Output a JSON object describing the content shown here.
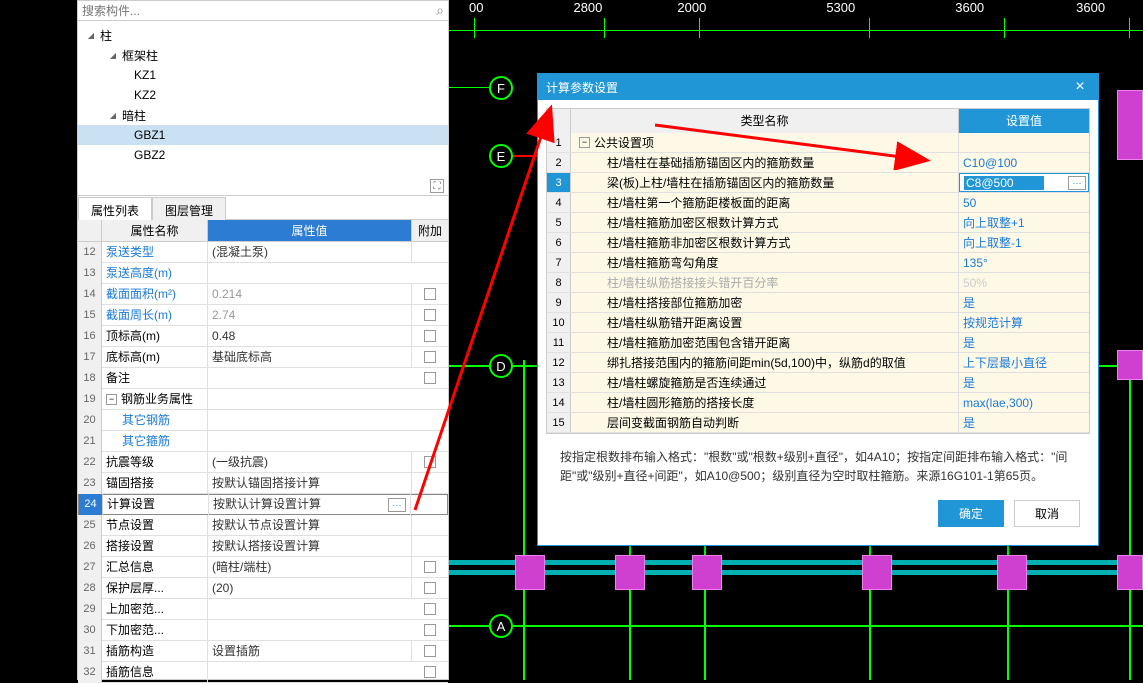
{
  "search": {
    "placeholder": "搜索构件..."
  },
  "tree": {
    "items": [
      {
        "label": "柱",
        "level": 0,
        "caret": true
      },
      {
        "label": "框架柱",
        "level": 1,
        "caret": true
      },
      {
        "label": "KZ1",
        "level": 2
      },
      {
        "label": "KZ2",
        "level": 2
      },
      {
        "label": "暗柱",
        "level": 1,
        "caret": true
      },
      {
        "label": "GBZ1",
        "level": 2,
        "selected": true
      },
      {
        "label": "GBZ2",
        "level": 2
      }
    ]
  },
  "tabs": [
    {
      "label": "属性列表",
      "active": true
    },
    {
      "label": "图层管理",
      "active": false
    }
  ],
  "property_header": {
    "name": "属性名称",
    "value": "属性值",
    "extra": "附加"
  },
  "properties": [
    {
      "num": "12",
      "name": "泵送类型",
      "value": "(混凝土泵)",
      "link": true
    },
    {
      "num": "13",
      "name": "泵送高度(m)",
      "value": "",
      "link": true
    },
    {
      "num": "14",
      "name": "截面面积(m²)",
      "value": "0.214",
      "link": true,
      "dim": true,
      "checkbox": true
    },
    {
      "num": "15",
      "name": "截面周长(m)",
      "value": "2.74",
      "link": true,
      "dim": true,
      "checkbox": true
    },
    {
      "num": "16",
      "name": "顶标高(m)",
      "value": "0.48",
      "checkbox": true
    },
    {
      "num": "17",
      "name": "底标高(m)",
      "value": "基础底标高",
      "checkbox": true
    },
    {
      "num": "18",
      "name": "备注",
      "value": "",
      "checkbox": true
    },
    {
      "num": "19",
      "name": "钢筋业务属性",
      "value": "",
      "group": true
    },
    {
      "num": "20",
      "name": "其它钢筋",
      "value": "",
      "sub": true
    },
    {
      "num": "21",
      "name": "其它箍筋",
      "value": "",
      "sub": true
    },
    {
      "num": "22",
      "name": "抗震等级",
      "value": "(一级抗震)",
      "checkbox": true
    },
    {
      "num": "23",
      "name": "锚固搭接",
      "value": "按默认锚固搭接计算"
    },
    {
      "num": "24",
      "name": "计算设置",
      "value": "按默认计算设置计算",
      "selected": true
    },
    {
      "num": "25",
      "name": "节点设置",
      "value": "按默认节点设置计算"
    },
    {
      "num": "26",
      "name": "搭接设置",
      "value": "按默认搭接设置计算"
    },
    {
      "num": "27",
      "name": "汇总信息",
      "value": "(暗柱/端柱)",
      "checkbox": true
    },
    {
      "num": "28",
      "name": "保护层厚...",
      "value": "(20)",
      "checkbox": true
    },
    {
      "num": "29",
      "name": "上加密范...",
      "value": "",
      "checkbox": true
    },
    {
      "num": "30",
      "name": "下加密范...",
      "value": "",
      "checkbox": true
    },
    {
      "num": "31",
      "name": "插筋构造",
      "value": "设置插筋",
      "checkbox": true
    },
    {
      "num": "32",
      "name": "插筋信息",
      "value": "",
      "checkbox": true
    }
  ],
  "ruler_values": [
    "00",
    "2800",
    "2000",
    "5300",
    "3600",
    "3600"
  ],
  "axis_labels": [
    "F",
    "E",
    "D",
    "A"
  ],
  "dialog": {
    "title": "计算参数设置",
    "header": {
      "type": "类型名称",
      "value": "设置值"
    },
    "rows": [
      {
        "num": "1",
        "name": "公共设置项",
        "value": "",
        "group": true
      },
      {
        "num": "2",
        "name": "柱/墙柱在基础插筋锚固区内的箍筋数量",
        "value": "C10@100"
      },
      {
        "num": "3",
        "name": "梁(板)上柱/墙柱在插筋锚固区内的箍筋数量",
        "value": "C8@500",
        "highlighted": true,
        "editing": true
      },
      {
        "num": "4",
        "name": "柱/墙柱第一个箍筋距楼板面的距离",
        "value": "50"
      },
      {
        "num": "5",
        "name": "柱/墙柱箍筋加密区根数计算方式",
        "value": "向上取整+1"
      },
      {
        "num": "6",
        "name": "柱/墙柱箍筋非加密区根数计算方式",
        "value": "向上取整-1"
      },
      {
        "num": "7",
        "name": "柱/墙柱箍筋弯勾角度",
        "value": "135°"
      },
      {
        "num": "8",
        "name": "柱/墙柱纵筋搭接接头错开百分率",
        "value": "50%",
        "dim": true
      },
      {
        "num": "9",
        "name": "柱/墙柱搭接部位箍筋加密",
        "value": "是"
      },
      {
        "num": "10",
        "name": "柱/墙柱纵筋错开距离设置",
        "value": "按规范计算"
      },
      {
        "num": "11",
        "name": "柱/墙柱箍筋加密范围包含错开距离",
        "value": "是"
      },
      {
        "num": "12",
        "name": "绑扎搭接范围内的箍筋间距min(5d,100)中，纵筋d的取值",
        "value": "上下层最小直径"
      },
      {
        "num": "13",
        "name": "柱/墙柱螺旋箍筋是否连续通过",
        "value": "是"
      },
      {
        "num": "14",
        "name": "柱/墙柱圆形箍筋的搭接长度",
        "value": "max(lae,300)"
      },
      {
        "num": "15",
        "name": "层间变截面钢筋自动判断",
        "value": "是"
      }
    ],
    "hint": "按指定根数排布输入格式：\"根数\"或\"根数+级别+直径\"，如4A10；按指定间距排布输入格式：\"间距\"或\"级别+直径+间距\"，如A10@500；级别直径为空时取柱箍筋。来源16G101-1第65页。",
    "ok": "确定",
    "cancel": "取消"
  }
}
